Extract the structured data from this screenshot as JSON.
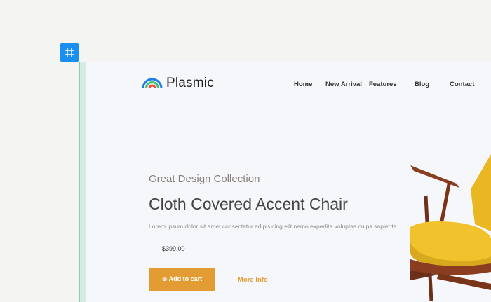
{
  "brand": {
    "name": "Plasmic"
  },
  "nav": {
    "items": [
      "Home",
      "New Arrival",
      "Features",
      "Blog",
      "Contact"
    ]
  },
  "hero": {
    "subtitle": "Great Design Collection",
    "title": "Cloth Covered Accent Chair",
    "description": "Lorem ipsum dolor sit amet consectetur adipisicing elit nemo expedita voluptas culpa sapiente.",
    "price": "$399.00",
    "add_to_cart": "⊕ Add to cart",
    "more_info": "More Info"
  },
  "icons": {
    "frame_tool": "frame-icon",
    "logo": "rainbow-logo-icon"
  },
  "colors": {
    "accent": "#e39c33",
    "tool_blue": "#1a8ff0",
    "chair_yellow": "#f2c22c"
  }
}
